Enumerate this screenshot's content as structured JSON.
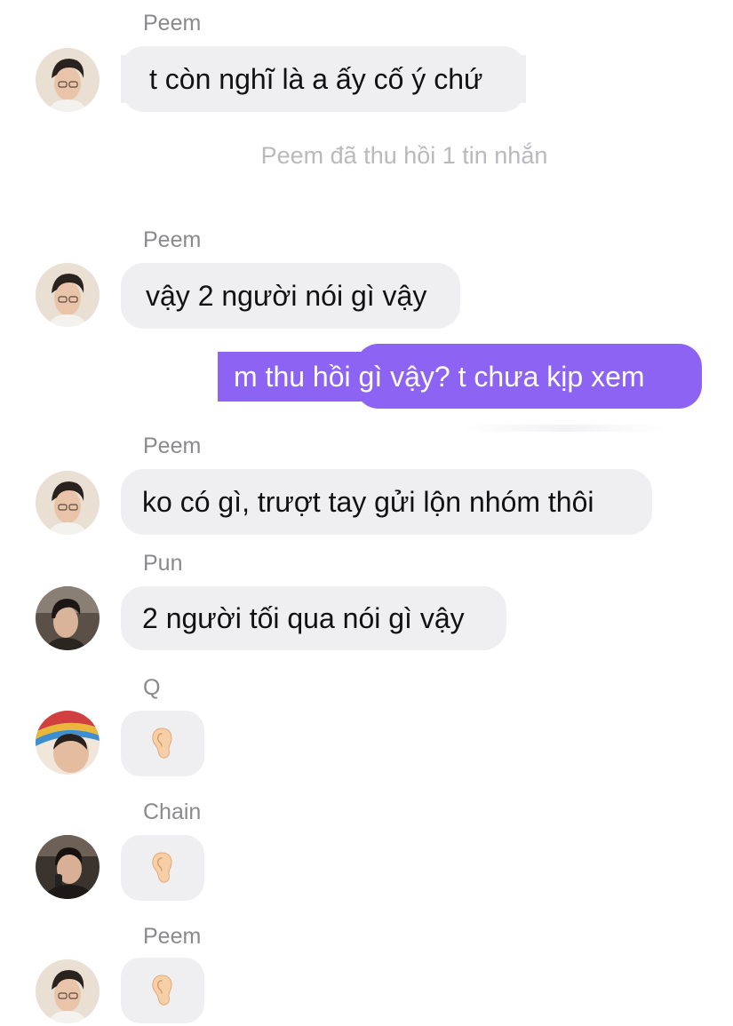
{
  "messages": {
    "m1": {
      "sender": "Peem",
      "text": "t còn nghĩ là a ấy cố ý chứ"
    },
    "system_recall": "Peem đã thu hồi 1 tin nhắn",
    "m2": {
      "sender": "Peem",
      "text": "vậy 2 người nói gì vậy"
    },
    "m3_outgoing": {
      "text": "m thu hồi gì vậy? t chưa kịp xem"
    },
    "m4": {
      "sender": "Peem",
      "text": "ko có gì, trượt tay gửi lộn nhóm thôi"
    },
    "m5": {
      "sender": "Pun",
      "text": "2 người tối qua nói gì vậy"
    },
    "m6": {
      "sender": "Q",
      "reaction": "ear-emoji"
    },
    "m7": {
      "sender": "Chain",
      "reaction": "ear-emoji"
    },
    "m8": {
      "sender": "Peem",
      "reaction": "ear-emoji"
    }
  },
  "colors": {
    "incoming_bubble": "#efeff2",
    "outgoing_bubble": "#8c63f2",
    "sender_name": "#8a8a8e",
    "system_text": "#b9b9be"
  }
}
